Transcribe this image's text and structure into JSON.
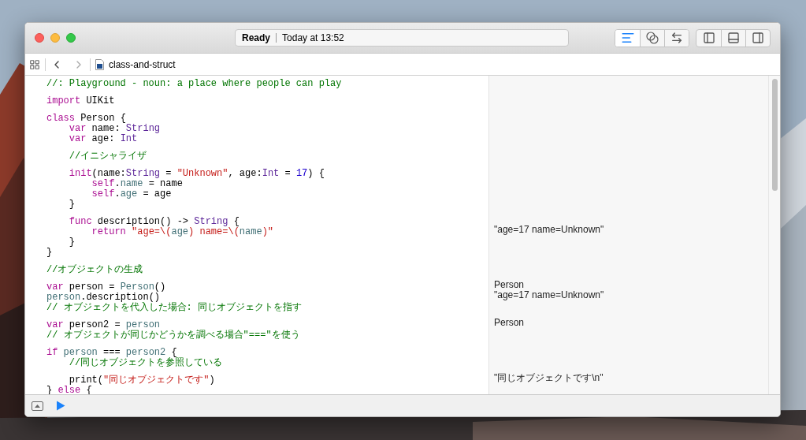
{
  "window": {
    "status": {
      "state": "Ready",
      "time": "Today at 13:52"
    },
    "editor_modes": [
      {
        "selected": true
      },
      {
        "selected": false
      },
      {
        "selected": false
      }
    ],
    "panels": [
      {
        "selected": false
      },
      {
        "selected": false
      },
      {
        "selected": false
      }
    ]
  },
  "jump_bar": {
    "file": "class-and-struct"
  },
  "code": [
    {
      "lines": [
        {
          "tokens": [
            {
              "kind": "comment",
              "text": "//: Playground - noun: a place where people can play"
            }
          ]
        }
      ]
    },
    {
      "lines": [
        {
          "tokens": [
            {
              "kind": "keyword",
              "text": "import"
            },
            {
              "kind": "plain",
              "text": " UIKit"
            }
          ]
        }
      ]
    },
    {
      "lines": [
        {
          "tokens": [
            {
              "kind": "keyword",
              "text": "class"
            },
            {
              "kind": "plain",
              "text": " Person {"
            }
          ]
        },
        {
          "tokens": [
            {
              "kind": "keyword",
              "text": "    var"
            },
            {
              "kind": "plain",
              "text": " name: "
            },
            {
              "kind": "type",
              "text": "String"
            }
          ]
        },
        {
          "tokens": [
            {
              "kind": "keyword",
              "text": "    var"
            },
            {
              "kind": "plain",
              "text": " age: "
            },
            {
              "kind": "type",
              "text": "Int"
            }
          ]
        }
      ]
    },
    {
      "lines": [
        {
          "tokens": [
            {
              "kind": "comment",
              "text": "    //イニシャライザ"
            }
          ]
        }
      ]
    },
    {
      "lines": [
        {
          "tokens": [
            {
              "kind": "keyword",
              "text": "    init"
            },
            {
              "kind": "plain",
              "text": "(name:"
            },
            {
              "kind": "type",
              "text": "String"
            },
            {
              "kind": "plain",
              "text": " = "
            },
            {
              "kind": "string",
              "text": "\"Unknown\""
            },
            {
              "kind": "plain",
              "text": ", age:"
            },
            {
              "kind": "type",
              "text": "Int"
            },
            {
              "kind": "plain",
              "text": " = "
            },
            {
              "kind": "number",
              "text": "17"
            },
            {
              "kind": "plain",
              "text": ") {"
            }
          ]
        },
        {
          "tokens": [
            {
              "kind": "keyword",
              "text": "        self"
            },
            {
              "kind": "plain",
              "text": "."
            },
            {
              "kind": "ident",
              "text": "name"
            },
            {
              "kind": "plain",
              "text": " = name"
            }
          ]
        },
        {
          "tokens": [
            {
              "kind": "keyword",
              "text": "        self"
            },
            {
              "kind": "plain",
              "text": "."
            },
            {
              "kind": "ident",
              "text": "age"
            },
            {
              "kind": "plain",
              "text": " = age"
            }
          ]
        },
        {
          "tokens": [
            {
              "kind": "plain",
              "text": "    }"
            }
          ]
        }
      ]
    },
    {
      "lines": [
        {
          "tokens": [
            {
              "kind": "keyword",
              "text": "    func"
            },
            {
              "kind": "plain",
              "text": " description() -> "
            },
            {
              "kind": "type",
              "text": "String"
            },
            {
              "kind": "plain",
              "text": " {"
            }
          ]
        },
        {
          "tokens": [
            {
              "kind": "keyword",
              "text": "        return"
            },
            {
              "kind": "string",
              "text": " \"age=\\("
            },
            {
              "kind": "ident",
              "text": "age"
            },
            {
              "kind": "string",
              "text": ") name=\\("
            },
            {
              "kind": "ident",
              "text": "name"
            },
            {
              "kind": "string",
              "text": ")\""
            }
          ],
          "result": "\"age=17 name=Unknown\""
        },
        {
          "tokens": [
            {
              "kind": "plain",
              "text": "    }"
            }
          ]
        },
        {
          "tokens": [
            {
              "kind": "plain",
              "text": "}"
            }
          ]
        }
      ]
    },
    {
      "lines": [
        {
          "tokens": [
            {
              "kind": "comment",
              "text": "//オブジェクトの生成"
            }
          ]
        }
      ]
    },
    {
      "lines": [
        {
          "tokens": [
            {
              "kind": "keyword",
              "text": "var"
            },
            {
              "kind": "plain",
              "text": " person = "
            },
            {
              "kind": "ident",
              "text": "Person"
            },
            {
              "kind": "plain",
              "text": "()"
            }
          ],
          "result": "Person"
        },
        {
          "tokens": [
            {
              "kind": "ident",
              "text": "person"
            },
            {
              "kind": "plain",
              "text": ".description()"
            }
          ],
          "result": "\"age=17 name=Unknown\""
        },
        {
          "tokens": [
            {
              "kind": "comment",
              "text": "// オブジェクトを代入した場合: 同じオブジェクトを指す"
            }
          ]
        }
      ]
    },
    {
      "lines": [
        {
          "tokens": [
            {
              "kind": "keyword",
              "text": "var"
            },
            {
              "kind": "plain",
              "text": " person2 = "
            },
            {
              "kind": "ident",
              "text": "person"
            }
          ],
          "result": "Person"
        },
        {
          "tokens": [
            {
              "kind": "comment",
              "text": "// オブジェクトが同じかどうかを調べる場合\"===\"を使う"
            }
          ]
        }
      ]
    },
    {
      "lines": [
        {
          "tokens": [
            {
              "kind": "keyword",
              "text": "if"
            },
            {
              "kind": "ident",
              "text": " person"
            },
            {
              "kind": "plain",
              "text": " === "
            },
            {
              "kind": "ident",
              "text": "person2"
            },
            {
              "kind": "plain",
              "text": " {"
            }
          ]
        },
        {
          "tokens": [
            {
              "kind": "comment",
              "text": "    //同じオブジェクトを参照している"
            }
          ]
        }
      ]
    },
    {
      "lines": [
        {
          "tokens": [
            {
              "kind": "plain",
              "text": "    print("
            },
            {
              "kind": "string",
              "text": "\"同じオブジェクトです\""
            },
            {
              "kind": "plain",
              "text": ")"
            }
          ],
          "result": "\"同じオブジェクトです\\n\""
        },
        {
          "tokens": [
            {
              "kind": "plain",
              "text": "} "
            },
            {
              "kind": "keyword",
              "text": "else"
            },
            {
              "kind": "plain",
              "text": " {"
            }
          ]
        }
      ]
    }
  ]
}
